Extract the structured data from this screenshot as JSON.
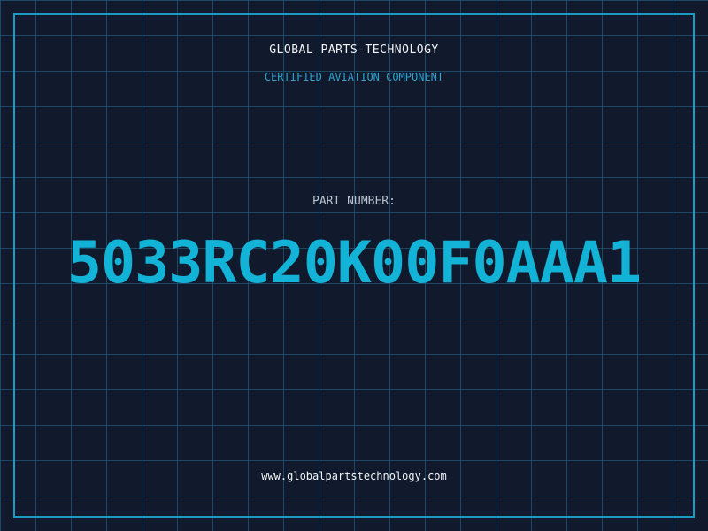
{
  "brand": {
    "name": "GLOBAL PARTS-TECHNOLOGY",
    "tagline": "CERTIFIED AVIATION COMPONENT"
  },
  "part": {
    "label": "PART NUMBER:",
    "number": "5033RC20K00F0AAA1"
  },
  "footer": {
    "url": "www.globalpartstechnology.com"
  },
  "colors": {
    "background": "#111a2d",
    "grid": "#286e8c",
    "accent": "#13b3d8",
    "frame": "#1a9cc4",
    "text": "#f2f4f7",
    "label": "#b9c2cd"
  }
}
